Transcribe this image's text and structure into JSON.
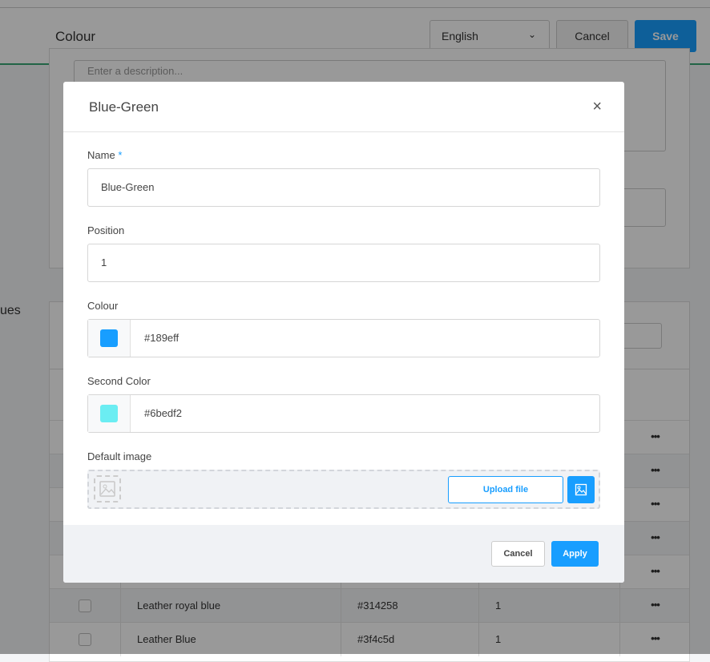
{
  "header": {
    "title": "Colour",
    "language": "English",
    "cancel": "Cancel",
    "save": "Save"
  },
  "background": {
    "description_placeholder": "Enter a description...",
    "section_label_fragment": "ues",
    "rows": [
      {
        "name": "",
        "hex": "",
        "position": ""
      },
      {
        "name": "",
        "hex": "",
        "position": ""
      },
      {
        "name": "",
        "hex": "",
        "position": ""
      },
      {
        "name": "",
        "hex": "",
        "position": ""
      },
      {
        "name": "",
        "hex": "",
        "position": ""
      },
      {
        "name": "Leather royal blue",
        "hex": "#314258",
        "position": "1"
      },
      {
        "name": "Leather Blue",
        "hex": "#3f4c5d",
        "position": "1"
      }
    ],
    "row_actions": "•••"
  },
  "modal": {
    "title": "Blue-Green",
    "close": "×",
    "name_label": "Name",
    "required_mark": "*",
    "name_value": "Blue-Green",
    "position_label": "Position",
    "position_value": "1",
    "colour_label": "Colour",
    "colour_value": "#189eff",
    "second_color_label": "Second Color",
    "second_color_value": "#6bedf2",
    "default_image_label": "Default image",
    "upload_label": "Upload file",
    "cancel": "Cancel",
    "apply": "Apply"
  },
  "colors": {
    "accent": "#189eff",
    "header_border": "#3aa776"
  }
}
